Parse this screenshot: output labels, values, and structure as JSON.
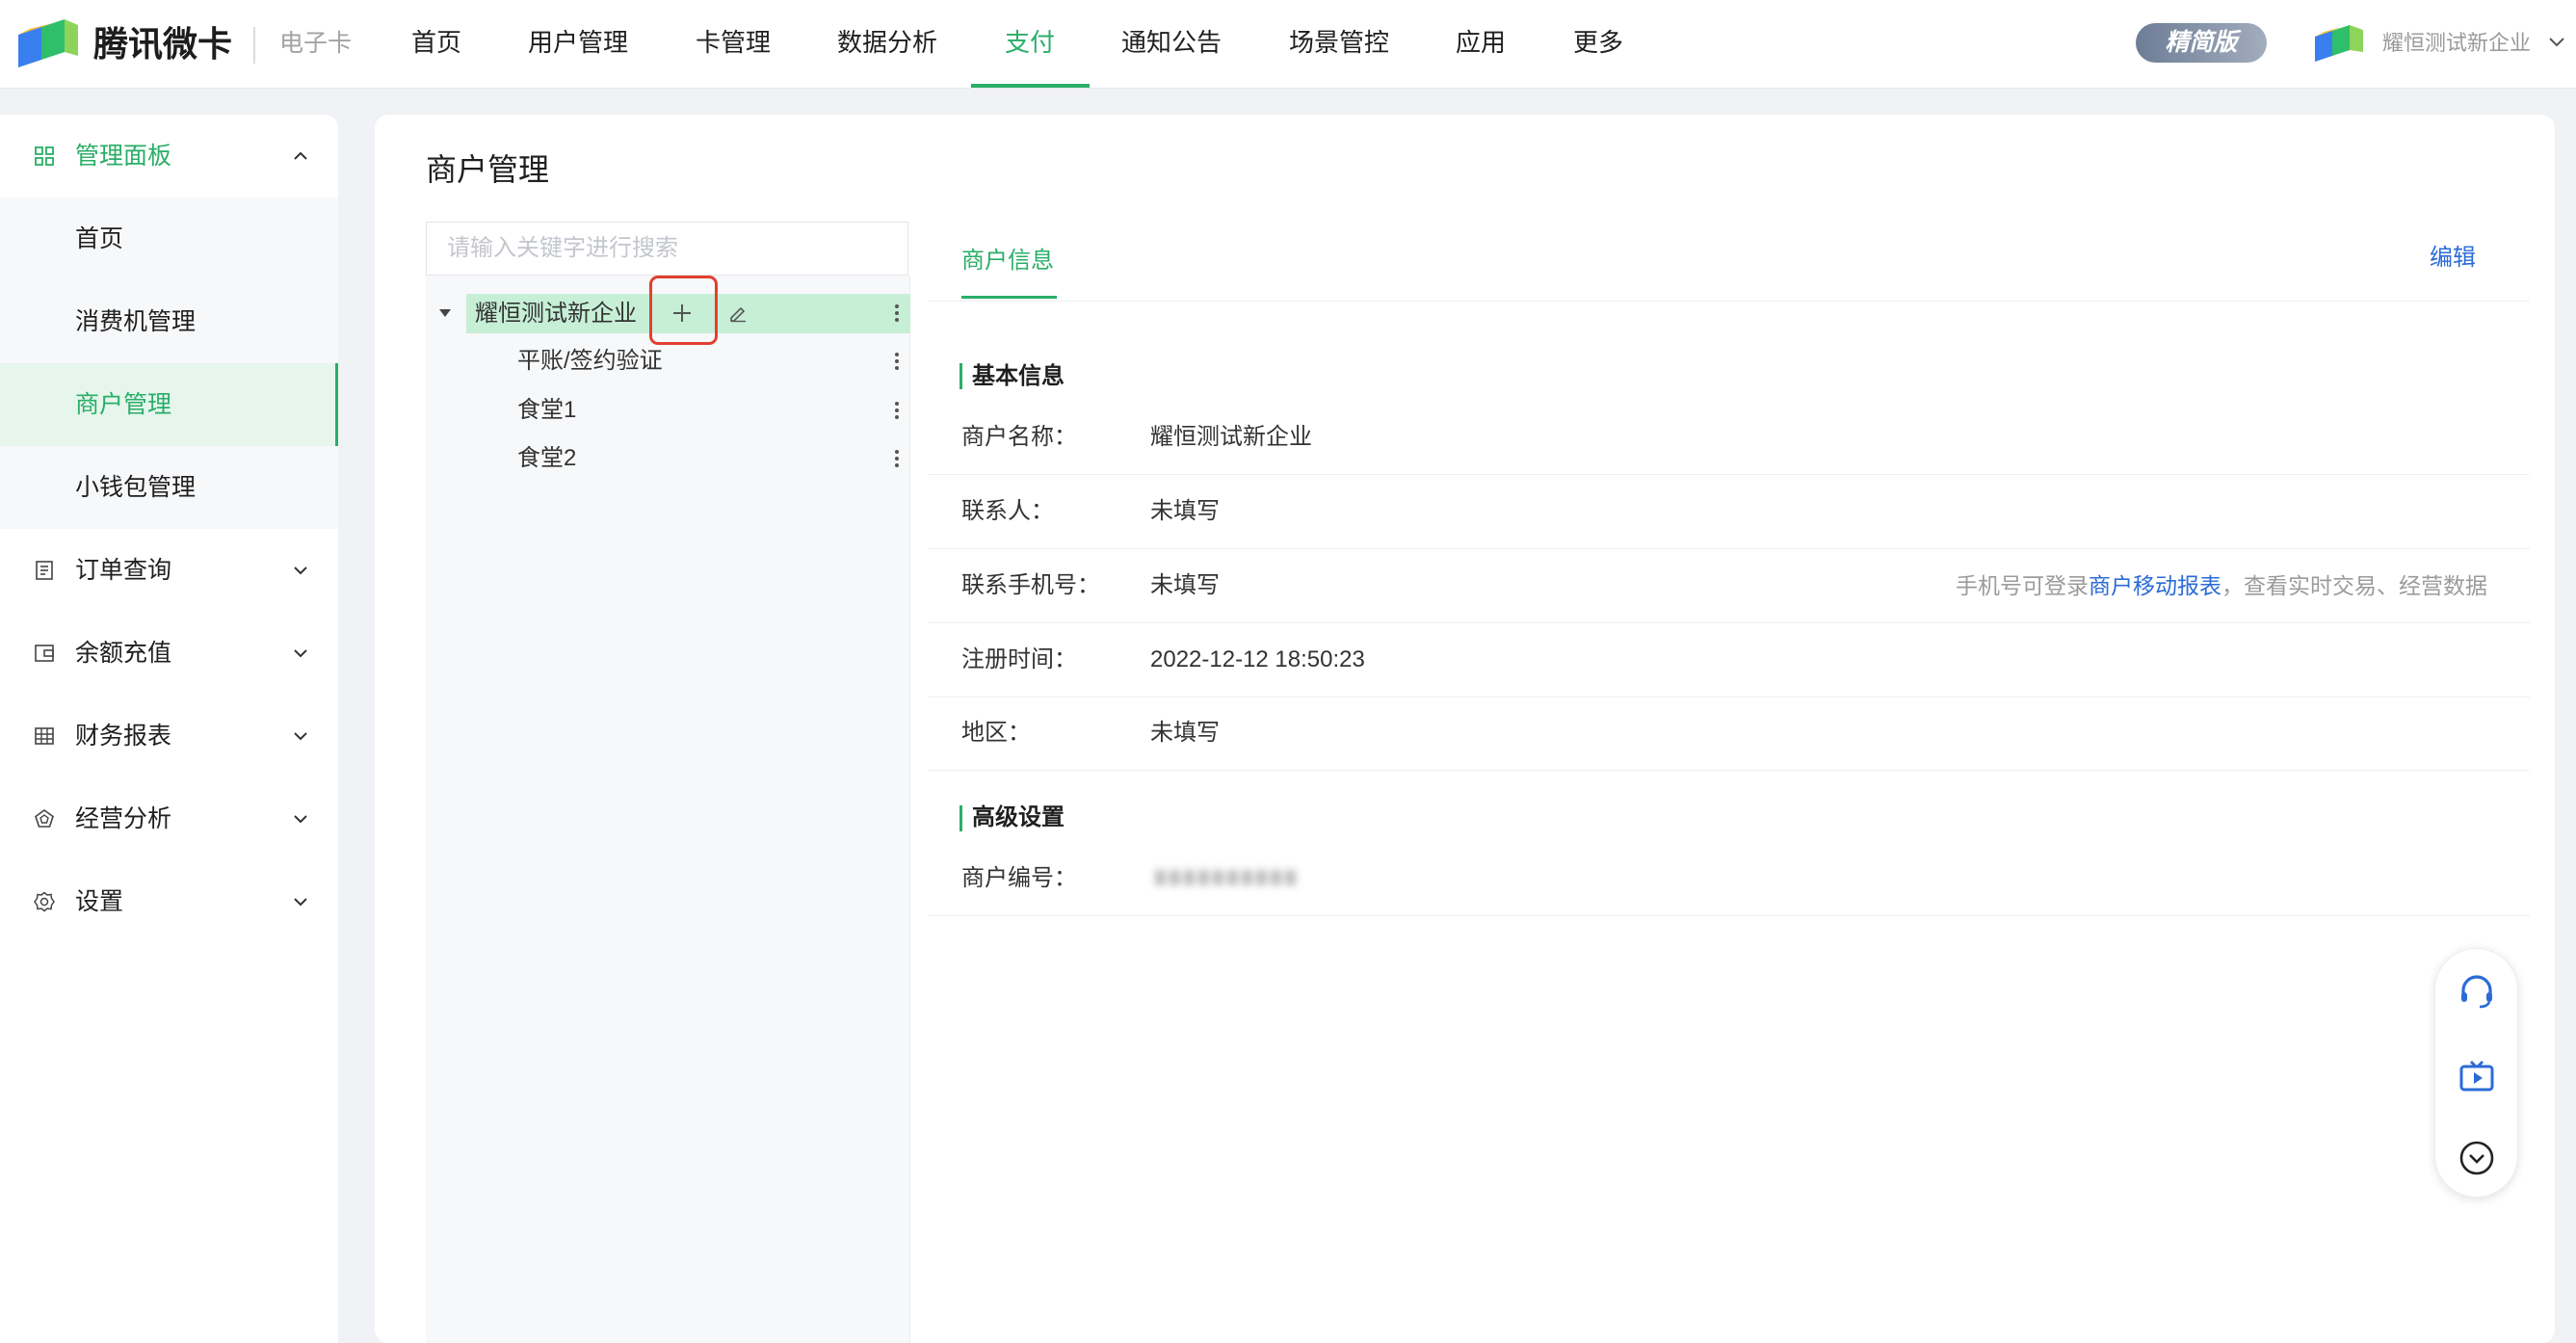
{
  "theme": {
    "accent": "#2aae67",
    "link": "#2b6bd6",
    "highlight_box": "#e2402f"
  },
  "header": {
    "logo_icon": "tencent-weika-logo-icon",
    "brand": "腾讯微卡",
    "product": "电子卡",
    "nav": [
      {
        "label": "首页"
      },
      {
        "label": "用户管理"
      },
      {
        "label": "卡管理"
      },
      {
        "label": "数据分析"
      },
      {
        "label": "支付",
        "active": true
      },
      {
        "label": "通知公告"
      },
      {
        "label": "场景管控"
      },
      {
        "label": "应用"
      },
      {
        "label": "更多"
      }
    ],
    "edition_badge": "精简版",
    "org_icon": "org-logo-icon",
    "org_name": "耀恒测试新企业"
  },
  "sidebar": {
    "group": {
      "label": "管理面板",
      "icon": "grid-icon",
      "expanded": true,
      "items": [
        {
          "label": "首页"
        },
        {
          "label": "消费机管理"
        },
        {
          "label": "商户管理",
          "active": true
        },
        {
          "label": "小钱包管理"
        }
      ]
    },
    "menus": [
      {
        "label": "订单查询",
        "icon": "order-list-icon"
      },
      {
        "label": "余额充值",
        "icon": "wallet-icon"
      },
      {
        "label": "财务报表",
        "icon": "table-icon"
      },
      {
        "label": "经营分析",
        "icon": "analysis-icon"
      },
      {
        "label": "设置",
        "icon": "gear-icon"
      }
    ]
  },
  "page": {
    "title": "商户管理",
    "search": {
      "placeholder": "请输入关键字进行搜索",
      "value": ""
    },
    "tree": {
      "root": {
        "label": "耀恒测试新企业",
        "expanded": true,
        "selected": true
      },
      "children": [
        {
          "label": "平账/签约验证"
        },
        {
          "label": "食堂1"
        },
        {
          "label": "食堂2"
        }
      ]
    },
    "tabs": [
      {
        "label": "商户信息",
        "active": true
      }
    ],
    "edit_label": "编辑",
    "sections": {
      "basic": {
        "title": "基本信息",
        "rows": [
          {
            "label": "商户名称：",
            "value": "耀恒测试新企业"
          },
          {
            "label": "联系人：",
            "value": "未填写"
          },
          {
            "label": "联系手机号：",
            "value": "未填写",
            "hint_prefix": "手机号可登录",
            "hint_link": "商户移动报表",
            "hint_suffix": "，查看实时交易、经营数据"
          },
          {
            "label": "注册时间：",
            "value": "2022-12-12 18:50:23"
          },
          {
            "label": "地区：",
            "value": "未填写"
          }
        ]
      },
      "advanced": {
        "title": "高级设置",
        "rows": [
          {
            "label": "商户编号："
          }
        ]
      }
    }
  },
  "float_toolbar": {
    "buttons": [
      {
        "icon": "headset-icon"
      },
      {
        "icon": "tv-icon"
      },
      {
        "icon": "circle-chevron-down-icon"
      }
    ]
  }
}
